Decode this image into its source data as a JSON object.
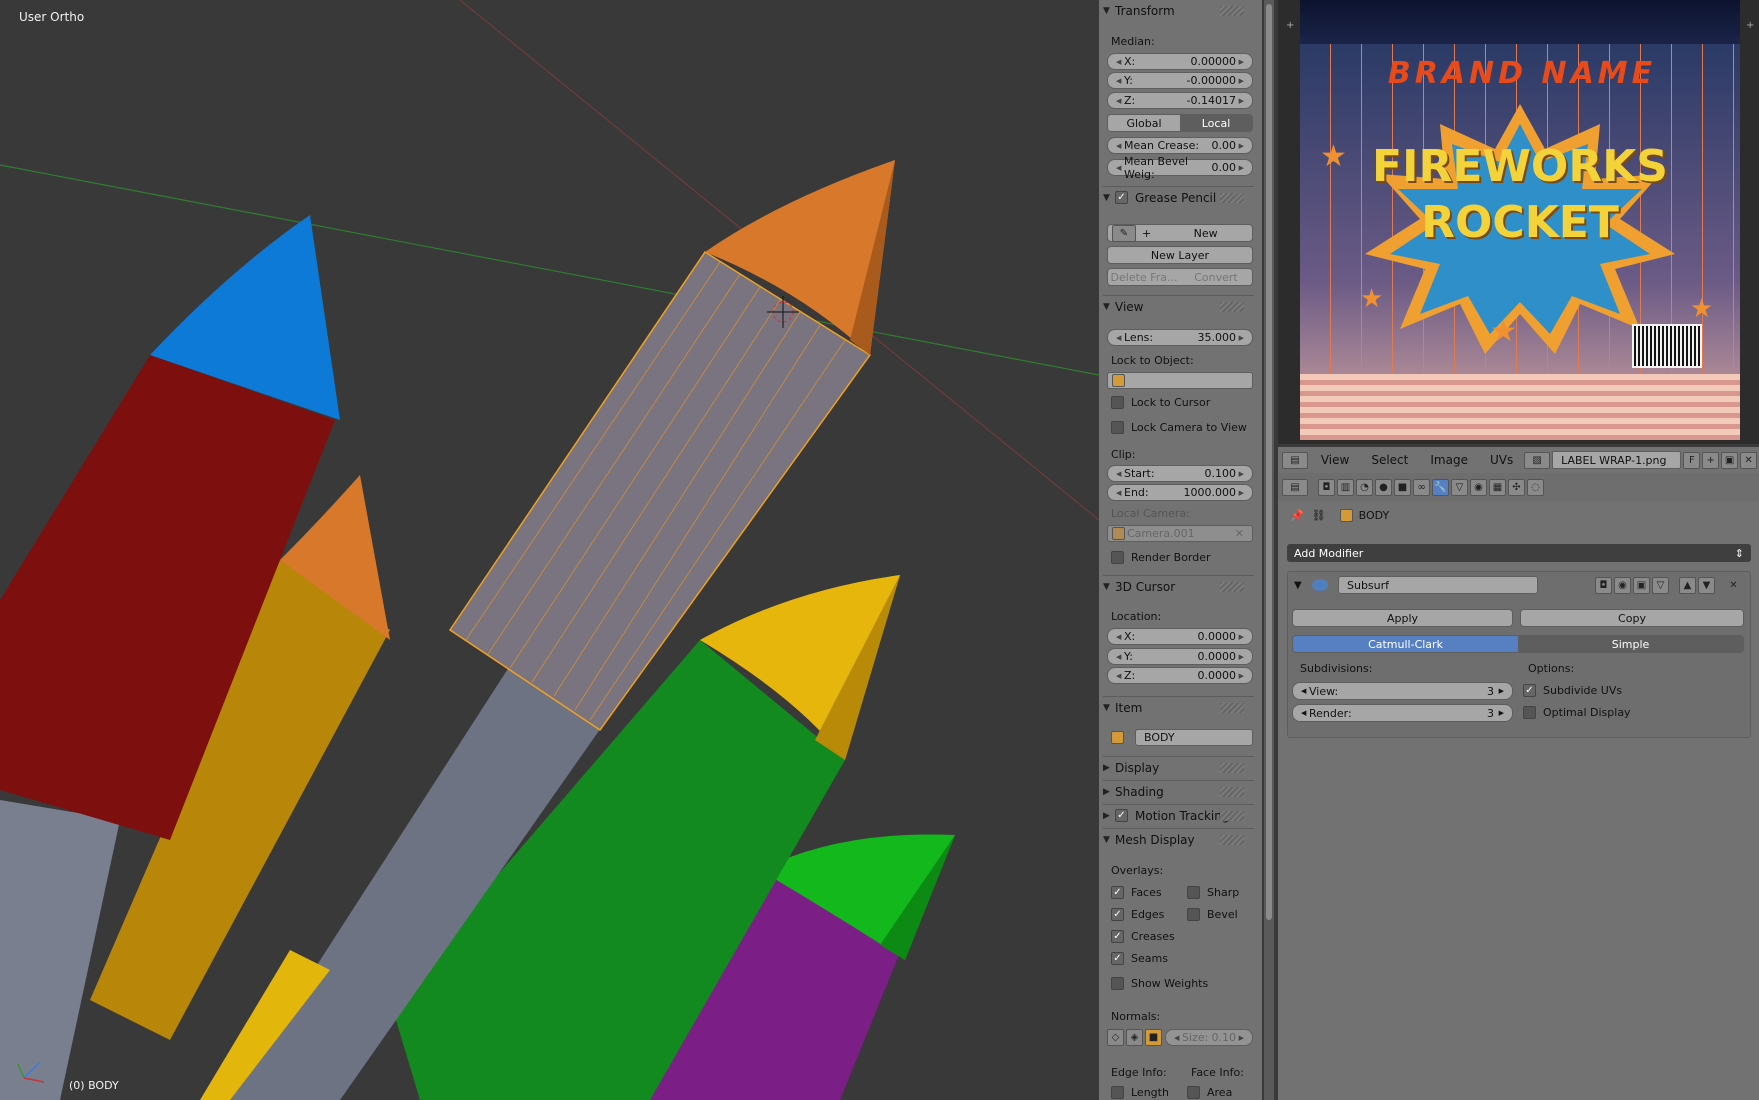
{
  "viewport": {
    "view_name": "User Ortho",
    "object_label": "(0) BODY"
  },
  "npanel": {
    "transform": {
      "title": "Transform",
      "median_label": "Median:",
      "x": {
        "label": "X:",
        "value": "0.00000"
      },
      "y": {
        "label": "Y:",
        "value": "-0.00000"
      },
      "z": {
        "label": "Z:",
        "value": "-0.14017"
      },
      "space_global": "Global",
      "space_local": "Local",
      "mean_crease": {
        "label": "Mean Crease:",
        "value": "0.00"
      },
      "mean_bevel": {
        "label": "Mean Bevel Weig:",
        "value": "0.00"
      }
    },
    "grease_pencil": {
      "title": "Grease Pencil",
      "new_label": "New",
      "new_layer_label": "New Layer",
      "delete_frame_label": "Delete Fra...",
      "convert_label": "Convert"
    },
    "view": {
      "title": "View",
      "lens": {
        "label": "Lens:",
        "value": "35.000"
      },
      "lock_to_object_label": "Lock to Object:",
      "lock_to_cursor": "Lock to Cursor",
      "lock_camera_to_view": "Lock Camera to View",
      "clip_label": "Clip:",
      "start": {
        "label": "Start:",
        "value": "0.100"
      },
      "end": {
        "label": "End:",
        "value": "1000.000"
      },
      "local_camera_label": "Local Camera:",
      "local_camera_value": "Camera.001",
      "render_border": "Render Border"
    },
    "cursor": {
      "title": "3D Cursor",
      "location_label": "Location:",
      "x": {
        "label": "X:",
        "value": "0.0000"
      },
      "y": {
        "label": "Y:",
        "value": "0.0000"
      },
      "z": {
        "label": "Z:",
        "value": "0.0000"
      }
    },
    "item": {
      "title": "Item",
      "name": "BODY"
    },
    "display": {
      "title": "Display"
    },
    "shading": {
      "title": "Shading"
    },
    "motion_tracking": {
      "title": "Motion Tracking"
    },
    "mesh_display": {
      "title": "Mesh Display",
      "overlays_label": "Overlays:",
      "faces": "Faces",
      "sharp": "Sharp",
      "edges": "Edges",
      "bevel": "Bevel",
      "creases": "Creases",
      "seams": "Seams",
      "show_weights": "Show Weights",
      "normals_label": "Normals:",
      "size": {
        "label": "Size:",
        "value": "0.10"
      },
      "edge_info_label": "Edge Info:",
      "face_info_label": "Face Info:",
      "length": "Length",
      "area": "Area"
    }
  },
  "image_editor": {
    "label_line1": "FIREWORKS",
    "label_line2": "ROCKET",
    "brand": "BRAND NAME",
    "menus": [
      "View",
      "Select",
      "Image",
      "UVs"
    ],
    "image_name": "LABEL WRAP-1.png",
    "fake_user": "F"
  },
  "properties": {
    "object_name": "BODY",
    "add_modifier": "Add Modifier",
    "modifier_name": "Subsurf",
    "apply": "Apply",
    "copy": "Copy",
    "catmull_clark": "Catmull-Clark",
    "simple": "Simple",
    "subdivisions_label": "Subdivisions:",
    "view": {
      "label": "View:",
      "value": "3"
    },
    "render": {
      "label": "Render:",
      "value": "3"
    },
    "options_label": "Options:",
    "subdivide_uvs": "Subdivide UVs",
    "optimal_display": "Optimal Display"
  }
}
